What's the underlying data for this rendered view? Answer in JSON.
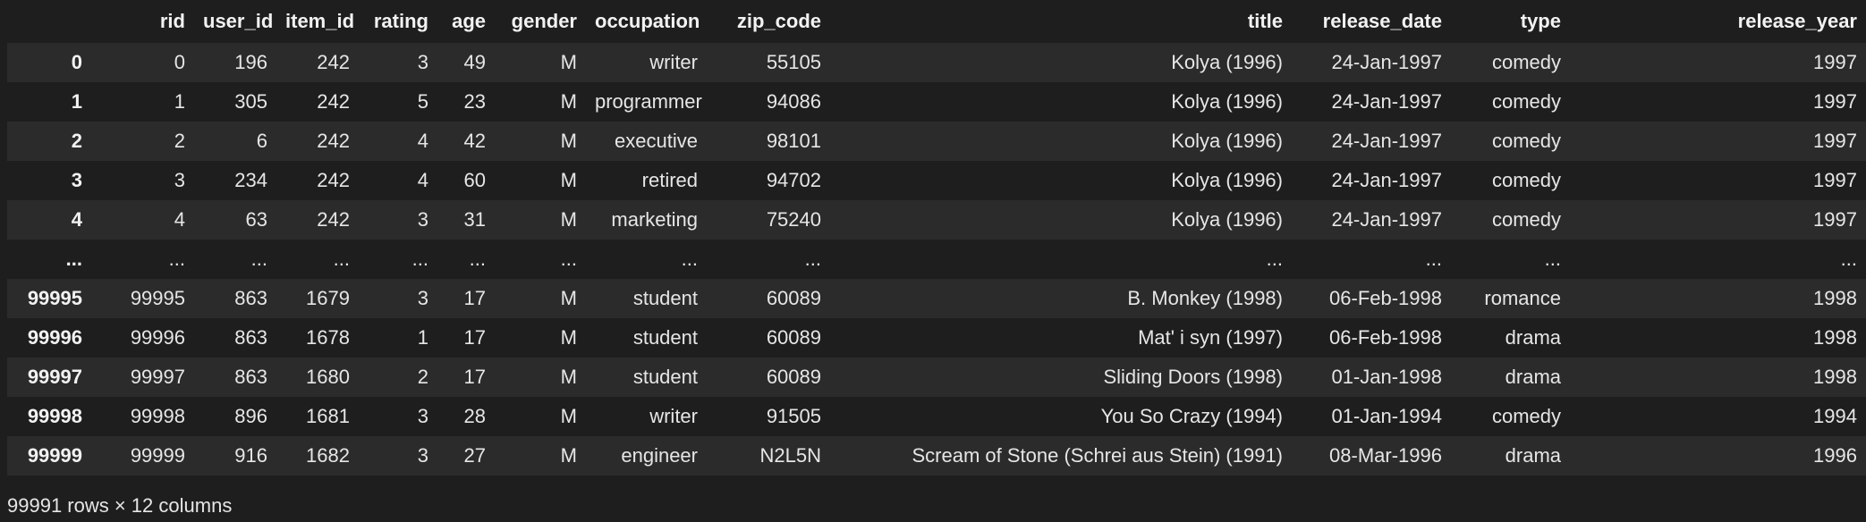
{
  "columns": [
    "",
    "rid",
    "user_id",
    "item_id",
    "rating",
    "age",
    "gender",
    "occupation",
    "zip_code",
    "title",
    "release_date",
    "type",
    "release_year"
  ],
  "rows": [
    [
      "0",
      "0",
      "196",
      "242",
      "3",
      "49",
      "M",
      "writer",
      "55105",
      "Kolya (1996)",
      "24-Jan-1997",
      "comedy",
      "1997"
    ],
    [
      "1",
      "1",
      "305",
      "242",
      "5",
      "23",
      "M",
      "programmer",
      "94086",
      "Kolya (1996)",
      "24-Jan-1997",
      "comedy",
      "1997"
    ],
    [
      "2",
      "2",
      "6",
      "242",
      "4",
      "42",
      "M",
      "executive",
      "98101",
      "Kolya (1996)",
      "24-Jan-1997",
      "comedy",
      "1997"
    ],
    [
      "3",
      "3",
      "234",
      "242",
      "4",
      "60",
      "M",
      "retired",
      "94702",
      "Kolya (1996)",
      "24-Jan-1997",
      "comedy",
      "1997"
    ],
    [
      "4",
      "4",
      "63",
      "242",
      "3",
      "31",
      "M",
      "marketing",
      "75240",
      "Kolya (1996)",
      "24-Jan-1997",
      "comedy",
      "1997"
    ],
    [
      "...",
      "...",
      "...",
      "...",
      "...",
      "...",
      "...",
      "...",
      "...",
      "...",
      "...",
      "...",
      "..."
    ],
    [
      "99995",
      "99995",
      "863",
      "1679",
      "3",
      "17",
      "M",
      "student",
      "60089",
      "B. Monkey (1998)",
      "06-Feb-1998",
      "romance",
      "1998"
    ],
    [
      "99996",
      "99996",
      "863",
      "1678",
      "1",
      "17",
      "M",
      "student",
      "60089",
      "Mat' i syn (1997)",
      "06-Feb-1998",
      "drama",
      "1998"
    ],
    [
      "99997",
      "99997",
      "863",
      "1680",
      "2",
      "17",
      "M",
      "student",
      "60089",
      "Sliding Doors (1998)",
      "01-Jan-1998",
      "drama",
      "1998"
    ],
    [
      "99998",
      "99998",
      "896",
      "1681",
      "3",
      "28",
      "M",
      "writer",
      "91505",
      "You So Crazy (1994)",
      "01-Jan-1994",
      "comedy",
      "1994"
    ],
    [
      "99999",
      "99999",
      "916",
      "1682",
      "3",
      "27",
      "M",
      "engineer",
      "N2L5N",
      "Scream of Stone (Schrei aus Stein) (1991)",
      "08-Mar-1996",
      "drama",
      "1996"
    ]
  ],
  "footer": "99991 rows × 12 columns"
}
